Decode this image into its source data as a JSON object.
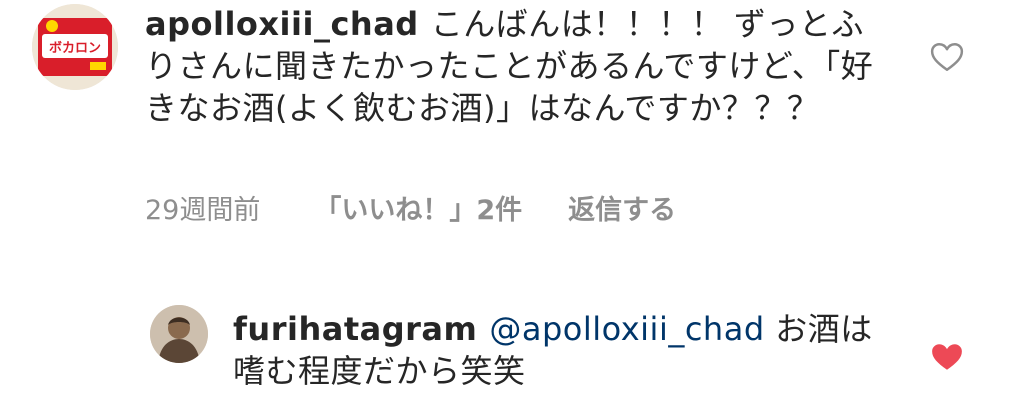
{
  "comments": [
    {
      "username": "apolloxiii_chad",
      "text": "こんばんは！！！！ ずっとふりさんに聞きたかったことがあるんですけど、「好きなお酒(よく飲むお酒)」はなんですか？？？",
      "avatar_icon": "candy-package-avatar",
      "time": "29週間前",
      "likes_label": "「いいね！」2件",
      "reply_label": "返信する",
      "liked": false,
      "heart_icon": "heart-outline-icon"
    },
    {
      "username": "furihatagram",
      "mention": "@apolloxiii_chad",
      "text": " お酒は嗜む程度だから笑笑",
      "avatar_icon": "person-photo-avatar",
      "liked": true,
      "heart_icon": "heart-filled-icon",
      "heart_color": "#ed4956"
    }
  ]
}
